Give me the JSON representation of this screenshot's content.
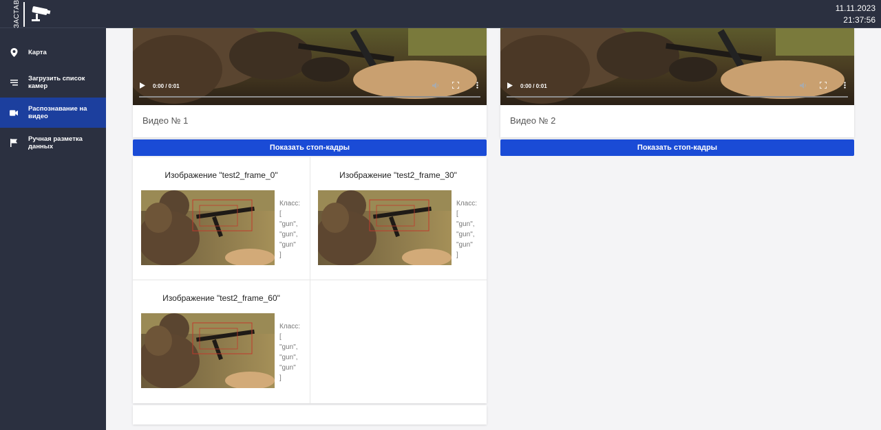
{
  "header": {
    "logo_text": "ЗАСТАВА",
    "date": "11.11.2023",
    "time": "21:37:56"
  },
  "sidebar": {
    "items": [
      {
        "label": "Карта",
        "icon": "map-pin-icon"
      },
      {
        "label": "Загрузить список камер",
        "icon": "list-icon"
      },
      {
        "label": "Распознавание на видео",
        "icon": "video-icon",
        "active": true
      },
      {
        "label": "Ручная разметка данных",
        "icon": "flag-icon"
      }
    ]
  },
  "videos": [
    {
      "title": "Видео № 1",
      "time": "0:00 / 0:01",
      "button": "Показать стоп-кадры"
    },
    {
      "title": "Видео № 2",
      "time": "0:00 / 0:01",
      "button": "Показать стоп-кадры"
    }
  ],
  "frames": [
    {
      "title": "Изображение \"test2_frame_0\"",
      "class_label": "Класс:",
      "classes": [
        "[",
        "\"gun\",",
        "\"gun\",",
        "\"gun\"",
        "]"
      ]
    },
    {
      "title": "Изображение \"test2_frame_30\"",
      "class_label": "Класс:",
      "classes": [
        "[",
        "\"gun\",",
        "\"gun\",",
        "\"gun\"",
        "]"
      ]
    },
    {
      "title": "Изображение \"test2_frame_60\"",
      "class_label": "Класс:",
      "classes": [
        "[",
        "\"gun\",",
        "\"gun\",",
        "\"gun\"",
        "]"
      ]
    }
  ],
  "colors": {
    "sidebar_bg": "#2b3040",
    "active_item": "#1c3f9e",
    "button": "#1a4bd6"
  }
}
